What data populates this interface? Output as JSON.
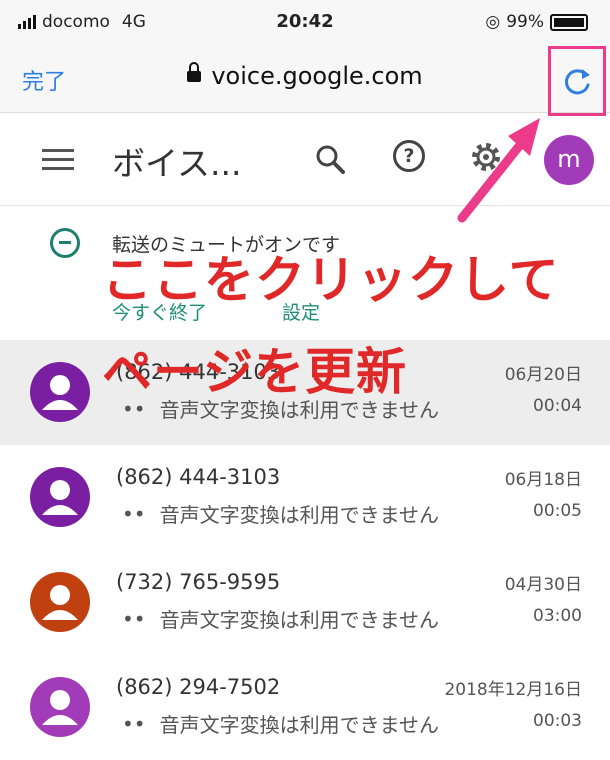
{
  "status_bar": {
    "carrier": "docomo",
    "network": "4G",
    "time": "20:42",
    "battery": "99%"
  },
  "browser": {
    "done_label": "完了",
    "url": "voice.google.com"
  },
  "app_bar": {
    "title": "ボイス...",
    "account_initial": "m"
  },
  "notice": {
    "text": "転送のミュートがオンです",
    "action_end": "今すぐ終了",
    "action_settings": "設定"
  },
  "annotation": {
    "line1": "ここをクリックして",
    "line2": "ページを更新",
    "color": "#e02828",
    "arrow_color": "#ec3b8a"
  },
  "voicemails": [
    {
      "phone": "(862) 444-3103",
      "transcript": "音声文字変換は利用できません",
      "date": "06月20日",
      "duration": "00:04",
      "avatar_color": "#7a1fa2"
    },
    {
      "phone": "(862) 444-3103",
      "transcript": "音声文字変換は利用できません",
      "date": "06月18日",
      "duration": "00:05",
      "avatar_color": "#7a1fa2"
    },
    {
      "phone": "(732) 765-9595",
      "transcript": "音声文字変換は利用できません",
      "date": "04月30日",
      "duration": "03:00",
      "avatar_color": "#c0400f"
    },
    {
      "phone": "(862) 294-7502",
      "transcript": "音声文字変換は利用できません",
      "date": "2018年12月16日",
      "duration": "00:03",
      "avatar_color": "#a23bb8"
    }
  ]
}
